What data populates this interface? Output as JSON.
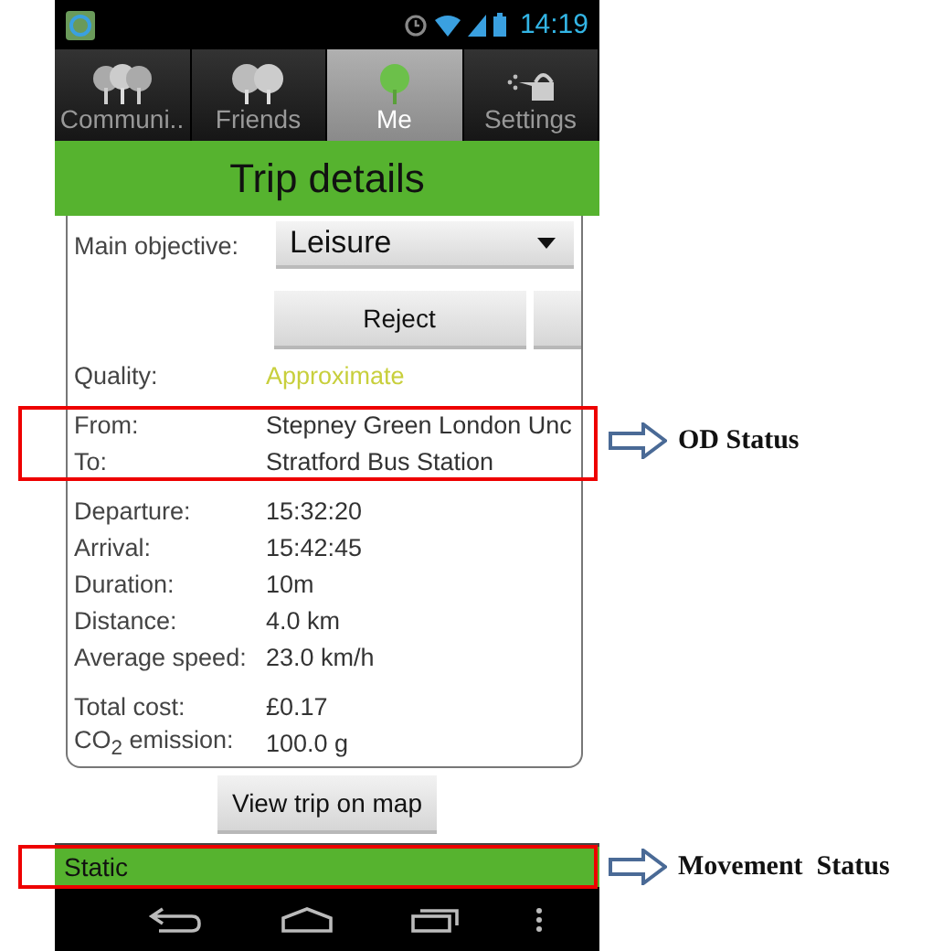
{
  "status_bar": {
    "time": "14:19"
  },
  "tabs": [
    {
      "label": "Communi..",
      "kind": "group",
      "selected": false
    },
    {
      "label": "Friends",
      "kind": "pair",
      "selected": false
    },
    {
      "label": "Me",
      "kind": "single",
      "selected": true
    },
    {
      "label": "Settings",
      "kind": "can",
      "selected": false
    }
  ],
  "title": "Trip details",
  "main_objective": {
    "label": "Main objective:",
    "value": "Leisure"
  },
  "reject_button": "Reject",
  "quality": {
    "label": "Quality:",
    "value": "Approximate"
  },
  "groups": [
    [
      {
        "label": "From:",
        "value": "Stepney Green London Unc"
      },
      {
        "label": "To:",
        "value": "Stratford Bus Station"
      }
    ],
    [
      {
        "label": "Departure:",
        "value": "15:32:20"
      },
      {
        "label": "Arrival:",
        "value": "15:42:45"
      },
      {
        "label": "Duration:",
        "value": "10m"
      },
      {
        "label": "Distance:",
        "value": "4.0 km"
      },
      {
        "label": "Average speed:",
        "value": "23.0 km/h"
      }
    ],
    [
      {
        "label": "Total cost:",
        "value": "£0.17"
      },
      {
        "label": "CO$_{2}$ emission:",
        "value": "100.0 g"
      }
    ]
  ],
  "view_map_button": "View trip on map",
  "movement_status": "Static",
  "annotations": [
    {
      "text": "OD Status"
    },
    {
      "text": "Movement  Status"
    }
  ]
}
